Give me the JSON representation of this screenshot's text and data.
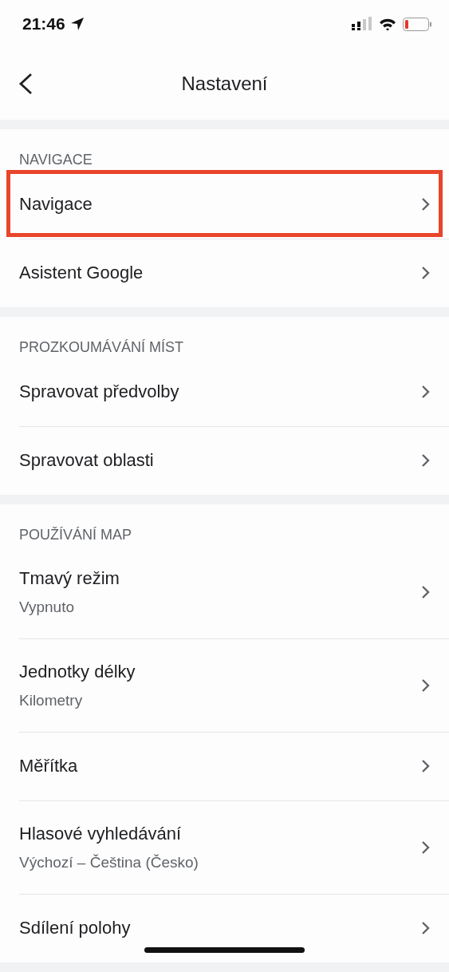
{
  "status_bar": {
    "time": "21:46"
  },
  "header": {
    "title": "Nastavení"
  },
  "sections": [
    {
      "title": "NAVIGACE",
      "items": [
        {
          "label": "Navigace",
          "highlighted": true
        },
        {
          "label": "Asistent Google",
          "highlighted": false
        }
      ]
    },
    {
      "title": "PROZKOUMÁVÁNÍ MÍST",
      "items": [
        {
          "label": "Spravovat předvolby",
          "highlighted": false
        },
        {
          "label": "Spravovat oblasti",
          "highlighted": false
        }
      ]
    },
    {
      "title": "POUŽÍVÁNÍ MAP",
      "items": [
        {
          "label": "Tmavý režim",
          "value": "Vypnuto",
          "highlighted": false
        },
        {
          "label": "Jednotky délky",
          "value": "Kilometry",
          "highlighted": false
        },
        {
          "label": "Měřítka",
          "highlighted": false
        },
        {
          "label": "Hlasové vyhledávání",
          "value": "Výchozí – Čeština (Česko)",
          "highlighted": false
        },
        {
          "label": "Sdílení polohy",
          "highlighted": false
        }
      ]
    }
  ]
}
